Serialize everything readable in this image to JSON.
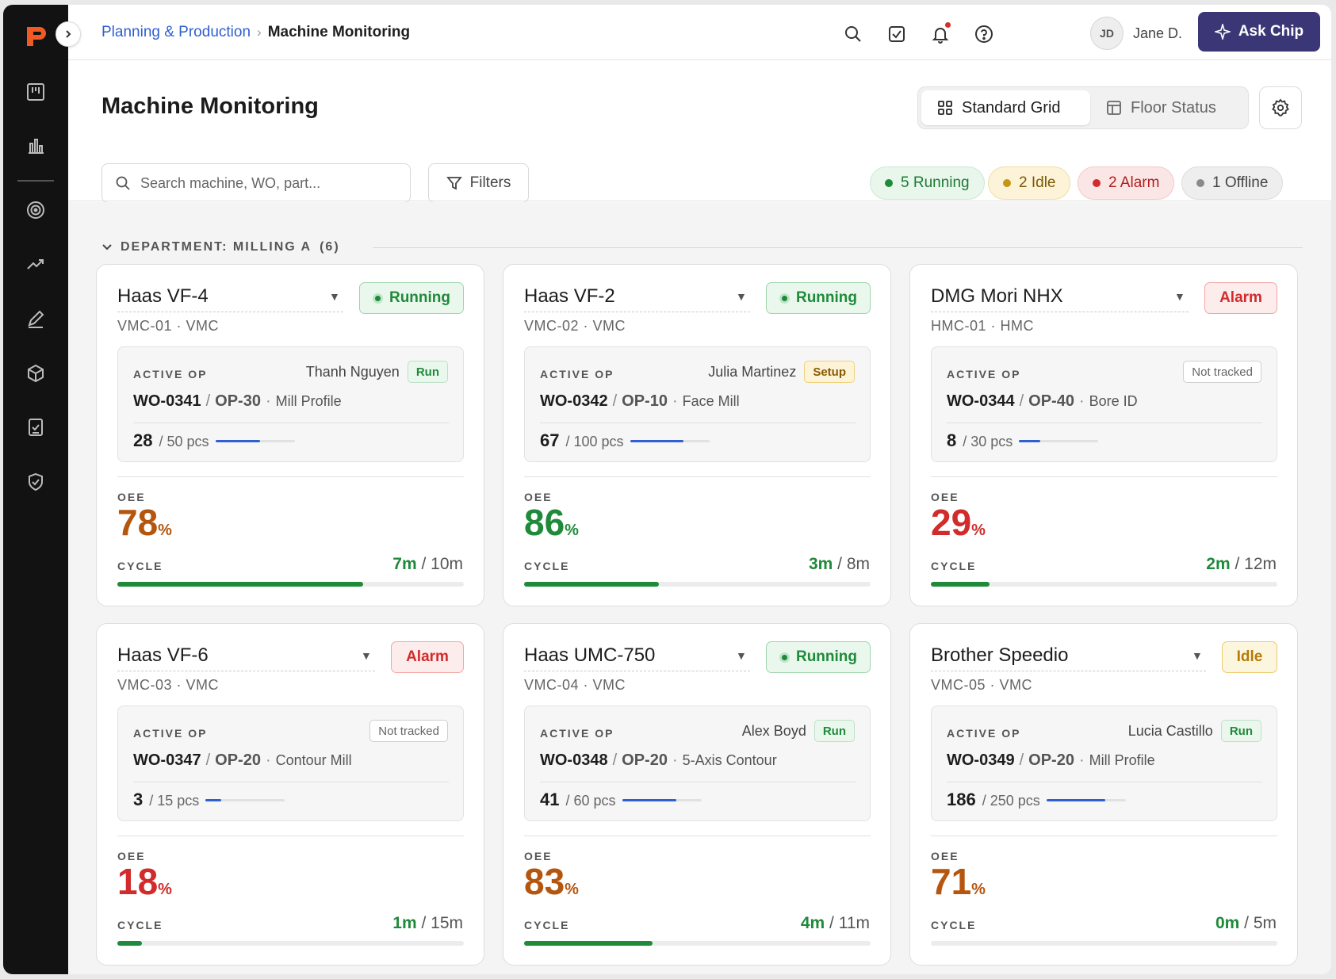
{
  "breadcrumb": {
    "parent": "Planning & Production",
    "current": "Machine Monitoring"
  },
  "user": {
    "initials": "JD",
    "name": "Jane D."
  },
  "ask_button": "Ask Chip",
  "page_title": "Machine Monitoring",
  "views": {
    "standard": "Standard Grid",
    "floor": "Floor Status"
  },
  "search": {
    "placeholder": "Search machine, WO, part..."
  },
  "filters_label": "Filters",
  "status_summary": [
    {
      "label": "5 Running",
      "color": "#1f8a3a"
    },
    {
      "label": "2 Idle",
      "color": "#c89512"
    },
    {
      "label": "2 Alarm",
      "color": "#d22b2b"
    },
    {
      "label": "1 Offline",
      "color": "#8a8a8a"
    }
  ],
  "department": {
    "label": "DEPARTMENT: MILLING A",
    "count": "(6)"
  },
  "labels": {
    "active_op": "ACTIVE OP",
    "oee": "OEE",
    "cycle": "CYCLE",
    "pct": "%"
  },
  "machines": [
    {
      "name": "Haas VF-4",
      "sub": "VMC-01 · VMC",
      "status": "Running",
      "status_kind": "running",
      "operator": "Thanh Nguyen",
      "op_tag": "Run",
      "tag_kind": "run",
      "wo": "WO-0341",
      "op": "OP-30",
      "desc": "Mill Profile",
      "done": "28",
      "total": "/ 50 pcs",
      "progress": 0.56,
      "oee": "78",
      "oee_color": "#b5560f",
      "cycle_cur": "7m",
      "cycle_total": "/ 10m",
      "cycle_progress": 0.71
    },
    {
      "name": "Haas VF-2",
      "sub": "VMC-02 · VMC",
      "status": "Running",
      "status_kind": "running",
      "operator": "Julia Martinez",
      "op_tag": "Setup",
      "tag_kind": "setup",
      "wo": "WO-0342",
      "op": "OP-10",
      "desc": "Face Mill",
      "done": "67",
      "total": "/ 100 pcs",
      "progress": 0.67,
      "oee": "86",
      "oee_color": "#1f8a3a",
      "cycle_cur": "3m",
      "cycle_total": "/ 8m",
      "cycle_progress": 0.39
    },
    {
      "name": "DMG Mori NHX",
      "sub": "HMC-01 · HMC",
      "status": "Alarm",
      "status_kind": "alarm",
      "operator": "",
      "op_tag": "Not tracked",
      "tag_kind": "nt",
      "wo": "WO-0344",
      "op": "OP-40",
      "desc": "Bore ID",
      "done": "8",
      "total": "/ 30 pcs",
      "progress": 0.27,
      "oee": "29",
      "oee_color": "#d22b2b",
      "cycle_cur": "2m",
      "cycle_total": "/ 12m",
      "cycle_progress": 0.17
    },
    {
      "name": "Haas VF-6",
      "sub": "VMC-03 · VMC",
      "status": "Alarm",
      "status_kind": "alarm",
      "operator": "",
      "op_tag": "Not tracked",
      "tag_kind": "nt",
      "wo": "WO-0347",
      "op": "OP-20",
      "desc": "Contour Mill",
      "done": "3",
      "total": "/ 15 pcs",
      "progress": 0.2,
      "oee": "18",
      "oee_color": "#d22b2b",
      "cycle_cur": "1m",
      "cycle_total": "/ 15m",
      "cycle_progress": 0.07
    },
    {
      "name": "Haas UMC-750",
      "sub": "VMC-04 · VMC",
      "status": "Running",
      "status_kind": "running",
      "operator": "Alex Boyd",
      "op_tag": "Run",
      "tag_kind": "run",
      "wo": "WO-0348",
      "op": "OP-20",
      "desc": "5-Axis Contour",
      "done": "41",
      "total": "/ 60 pcs",
      "progress": 0.68,
      "oee": "83",
      "oee_color": "#b5560f",
      "cycle_cur": "4m",
      "cycle_total": "/ 11m",
      "cycle_progress": 0.37
    },
    {
      "name": "Brother Speedio",
      "sub": "VMC-05 · VMC",
      "status": "Idle",
      "status_kind": "idle",
      "operator": "Lucia Castillo",
      "op_tag": "Run",
      "tag_kind": "run",
      "wo": "WO-0349",
      "op": "OP-20",
      "desc": "Mill Profile",
      "done": "186",
      "total": "/ 250 pcs",
      "progress": 0.74,
      "oee": "71",
      "oee_color": "#b5560f",
      "cycle_cur": "0m",
      "cycle_total": "/ 5m",
      "cycle_progress": 0.0
    }
  ]
}
